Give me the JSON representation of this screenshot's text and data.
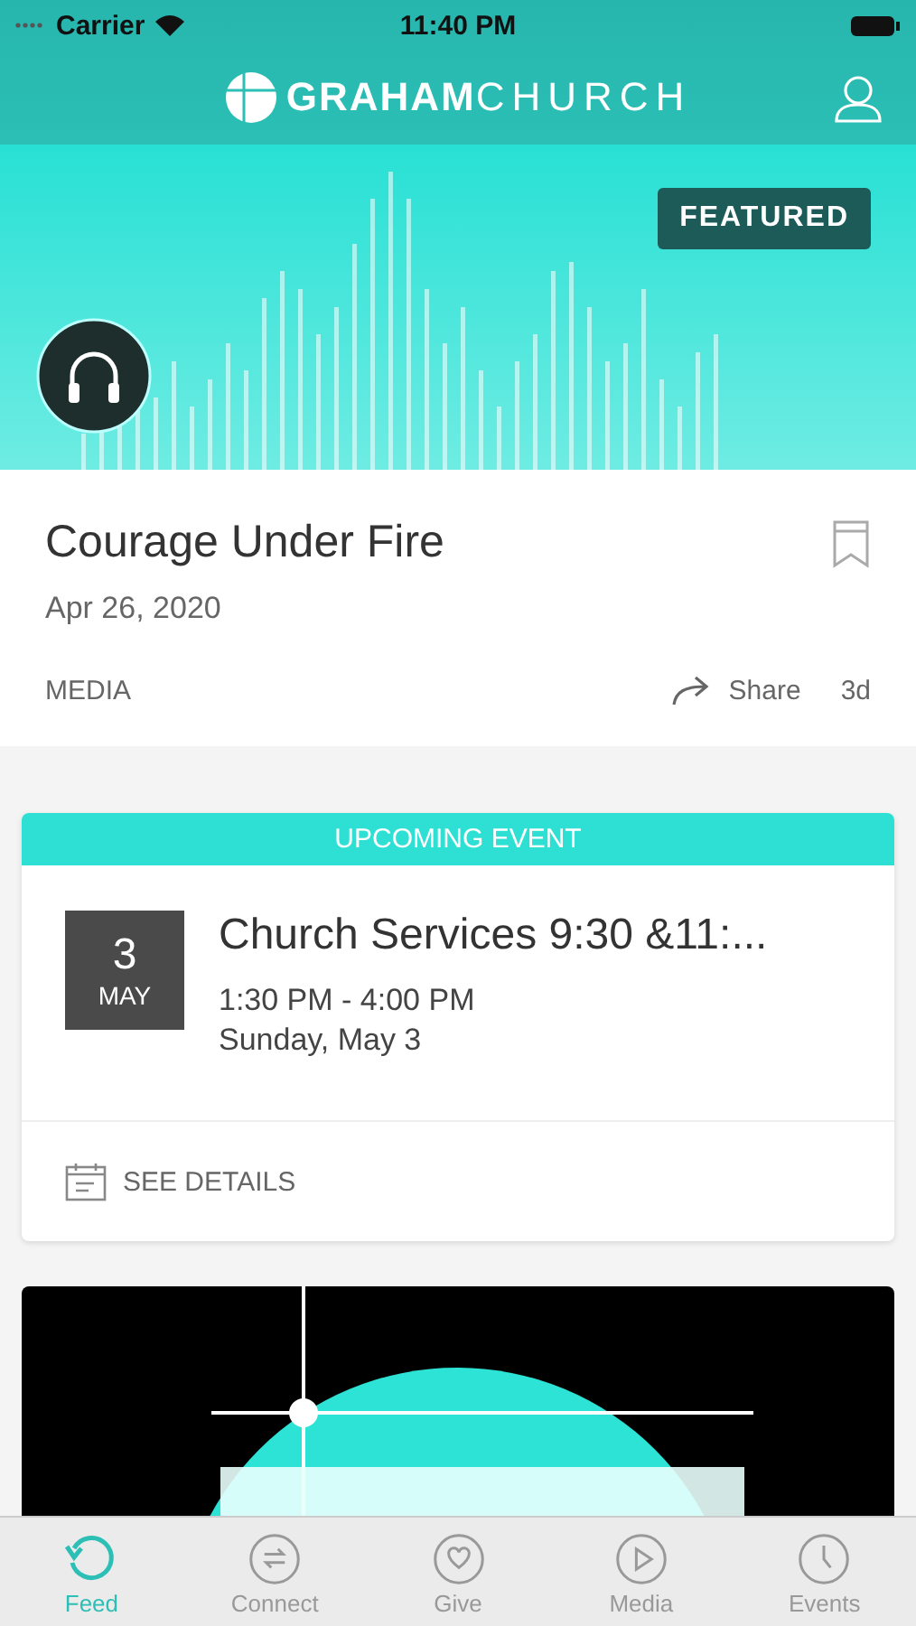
{
  "status_bar": {
    "carrier": "Carrier",
    "time": "11:40 PM"
  },
  "header": {
    "logo_bold": "GRAHAM",
    "logo_light": "CHURCH"
  },
  "featured": {
    "badge": "FEATURED",
    "title": "Courage Under Fire",
    "date": "Apr 26, 2020",
    "category": "MEDIA",
    "share": "Share",
    "age": "3d",
    "bookmarked": false
  },
  "event": {
    "banner": "UPCOMING EVENT",
    "day": "3",
    "month": "MAY",
    "title": "Church Services 9:30 &11:...",
    "time": "1:30 PM - 4:00 PM",
    "date": "Sunday, May 3",
    "action": "SEE DETAILS"
  },
  "tabs": [
    {
      "label": "Feed",
      "kind": "feed",
      "selected": true
    },
    {
      "label": "Connect",
      "kind": "connect",
      "selected": false
    },
    {
      "label": "Give",
      "kind": "give",
      "selected": false
    },
    {
      "label": "Media",
      "kind": "media",
      "selected": false
    },
    {
      "label": "Events",
      "kind": "events",
      "selected": false
    }
  ]
}
